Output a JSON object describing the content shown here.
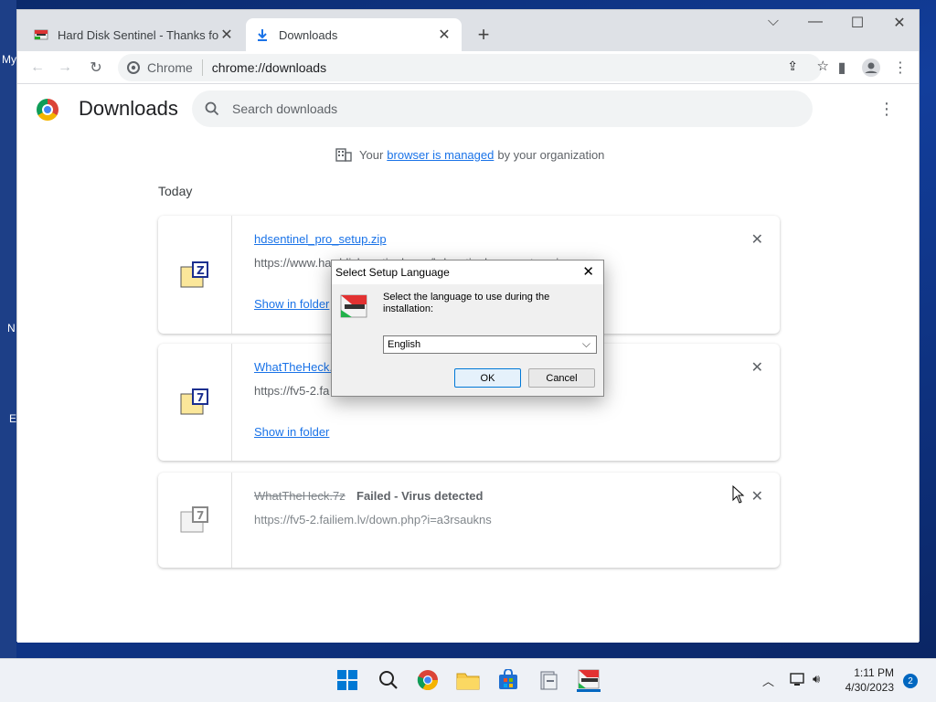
{
  "desktop": {
    "labels": [
      "My",
      "N",
      "E"
    ]
  },
  "browser": {
    "tabs": [
      {
        "title": "Hard Disk Sentinel - Thanks for d",
        "active": false
      },
      {
        "title": "Downloads",
        "active": true
      }
    ],
    "new_tab": "+",
    "omnibox": {
      "chip": "Chrome",
      "url": "chrome://downloads"
    },
    "window_controls": [
      "⌵",
      "—",
      "☐",
      "✕"
    ]
  },
  "downloads": {
    "title": "Downloads",
    "search_placeholder": "Search downloads",
    "managed_prefix": "Your",
    "managed_link": "browser is managed",
    "managed_suffix": "by your organization",
    "section": "Today",
    "items": [
      {
        "filename": "hdsentinel_pro_setup.zip",
        "url": "https://www.harddisksentinel.com/hdsentinel_pro_setup.zip",
        "action": "Show in folder",
        "status": ""
      },
      {
        "filename": "WhatTheHeck.",
        "url": "https://fv5-2.fa",
        "action": "Show in folder",
        "status": ""
      },
      {
        "filename": "WhatTheHeck.7z",
        "url": "https://fv5-2.failiem.lv/down.php?i=a3rsaukns",
        "action": "",
        "status": "Failed - Virus detected"
      }
    ]
  },
  "dialog": {
    "title": "Select Setup Language",
    "prompt": "Select the language to use during the installation:",
    "selected_language": "English",
    "ok_label": "OK",
    "cancel_label": "Cancel"
  },
  "taskbar": {
    "time": "1:11 PM",
    "date": "4/30/2023",
    "notification_count": "2"
  },
  "colors": {
    "link": "#1a73e8",
    "accent": "#0078d7"
  }
}
